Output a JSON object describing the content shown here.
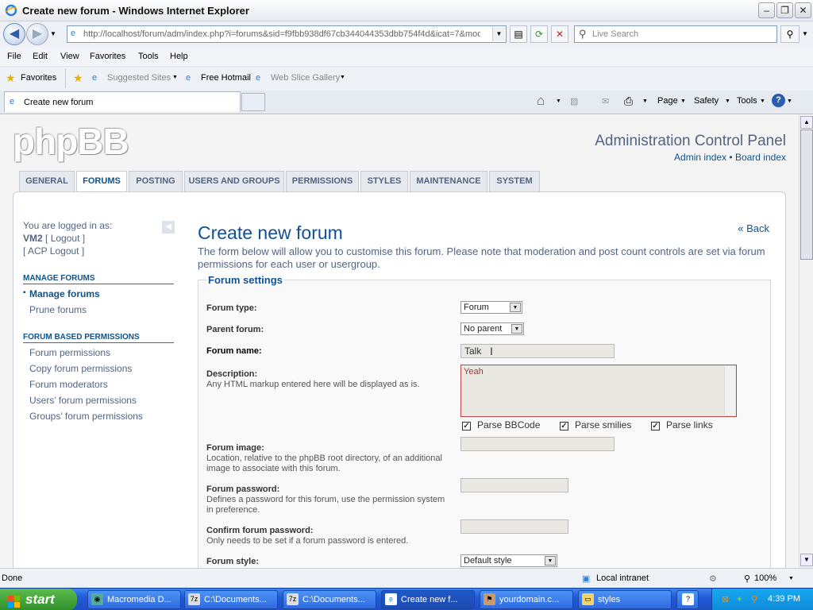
{
  "window": {
    "title": "Create new forum - Windows Internet Explorer"
  },
  "address": {
    "url": "http://localhost/forum/adm/index.php?i=forums&sid=f9fbb938df67cb344044353dbb754f4d&icat=7&mode",
    "search_placeholder": "Live Search"
  },
  "menubar": [
    "File",
    "Edit",
    "View",
    "Favorites",
    "Tools",
    "Help"
  ],
  "favorites": {
    "label": "Favorites",
    "items": [
      "Suggested Sites",
      "Free Hotmail",
      "Web Slice Gallery"
    ]
  },
  "tab": {
    "title": "Create new forum"
  },
  "commandbar": {
    "page": "Page",
    "safety": "Safety",
    "tools": "Tools"
  },
  "header": {
    "logo": "phpBB",
    "acp_title": "Administration Control Panel",
    "admin_index": "Admin index",
    "sep": "•",
    "board_index": "Board index"
  },
  "navtabs": [
    "GENERAL",
    "FORUMS",
    "POSTING",
    "USERS AND GROUPS",
    "PERMISSIONS",
    "STYLES",
    "MAINTENANCE",
    "SYSTEM"
  ],
  "sidebar": {
    "logged_in_as": "You are logged in as:",
    "user": "VM2",
    "logout": "[ Logout ]",
    "acp_logout": "[ ACP Logout ]",
    "section1": "MANAGE FORUMS",
    "section1_items": [
      "Manage forums",
      "Prune forums"
    ],
    "section2": "FORUM BASED PERMISSIONS",
    "section2_items": [
      "Forum permissions",
      "Copy forum permissions",
      "Forum moderators",
      "Users’ forum permissions",
      "Groups’ forum permissions"
    ]
  },
  "main": {
    "title": "Create new forum",
    "back": "« Back",
    "intro": "The form below will allow you to customise this forum. Please note that moderation and post count controls are set via forum permissions for each user or usergroup.",
    "legend": "Forum settings",
    "forum_type_label": "Forum type:",
    "forum_type_value": "Forum",
    "parent_label": "Parent forum:",
    "parent_value": "No parent",
    "name_label": "Forum name:",
    "name_value": "Talk",
    "desc_label": "Description:",
    "desc_explain": "Any HTML markup entered here will be displayed as is.",
    "desc_value": "Yeah",
    "parse_bbcode": "Parse BBCode",
    "parse_smilies": "Parse smilies",
    "parse_links": "Parse links",
    "image_label": "Forum image:",
    "image_explain": "Location, relative to the phpBB root directory, of an additional image to associate with this forum.",
    "password_label": "Forum password:",
    "password_explain": "Defines a password for this forum, use the permission system in preference.",
    "confirm_label": "Confirm forum password:",
    "confirm_explain": "Only needs to be set if a forum password is entered.",
    "style_label": "Forum style:",
    "style_value": "Default style"
  },
  "status": {
    "text": "Done",
    "zone": "Local intranet",
    "zoom": "100%"
  },
  "taskbar": {
    "start": "start",
    "tasks": [
      "Macromedia D...",
      "C:\\Documents...",
      "C:\\Documents...",
      "Create new f...",
      "yourdomain.c...",
      "styles"
    ],
    "clock": "4:39 PM"
  },
  "colors": {
    "accent": "#105289",
    "title_blue": "#115098",
    "error_border": "#b44"
  }
}
